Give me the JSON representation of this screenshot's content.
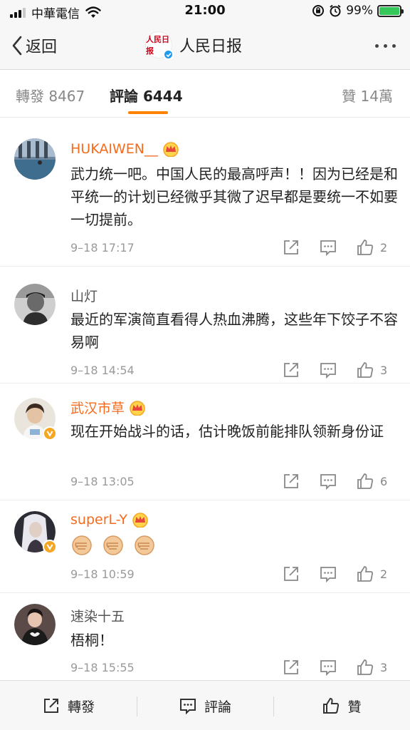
{
  "status_bar": {
    "carrier": "中華電信",
    "time": "21:00",
    "battery_percent": "99%",
    "battery_level": 0.99,
    "battery_color": "#35c759"
  },
  "nav": {
    "back_label": "返回",
    "title": "人民日报",
    "logo_text": "人民日报",
    "verified_color": "#1d9bf0"
  },
  "tabs": {
    "reposts": "轉發 8467",
    "comments": "評論 6444",
    "likes": "贊 14萬",
    "accent": "#ff8200"
  },
  "comments": [
    {
      "name": "HUKAIWEN__",
      "name_color": "#f56b1e",
      "vip_crown": true,
      "verified": false,
      "text": "武力统一吧。中国人民的最高呼声！！因为已经是和平统一的计划已经微乎其微了迟早都是要统一不如要一切提前。",
      "time": "9–18 17:17",
      "likes": "2"
    },
    {
      "name": "山灯",
      "name_color": "#555555",
      "vip_crown": false,
      "verified": false,
      "text": "最近的军演简直看得人热血沸腾，这些年下饺子不容易啊",
      "time": "9–18 14:54",
      "likes": "3"
    },
    {
      "name": "武汉市草",
      "name_color": "#f56b1e",
      "vip_crown": true,
      "verified": true,
      "text": "现在开始战斗的话，估计晚饭前能排队领新身份证",
      "time": "9–18 13:05",
      "likes": "6"
    },
    {
      "name": "superL-Y",
      "name_color": "#f56b1e",
      "vip_crown": true,
      "verified": true,
      "text": "",
      "emoji": [
        "fist-emoji",
        "fist-emoji",
        "fist-emoji"
      ],
      "time": "9–18 10:59",
      "likes": "2"
    },
    {
      "name": "速染十五",
      "name_color": "#555555",
      "vip_crown": false,
      "verified": false,
      "text": "梧桐！",
      "time": "9–18 15:55",
      "likes": "3"
    }
  ],
  "toolbar": {
    "repost_label": "轉發",
    "comment_label": "評論",
    "like_label": "贊"
  },
  "icons": {
    "back": "chevron-left-icon",
    "more": "more-dots-icon",
    "share": "share-icon",
    "reply": "comment-icon",
    "like": "thumbs-up-icon",
    "crown": "vip-crown-icon"
  }
}
